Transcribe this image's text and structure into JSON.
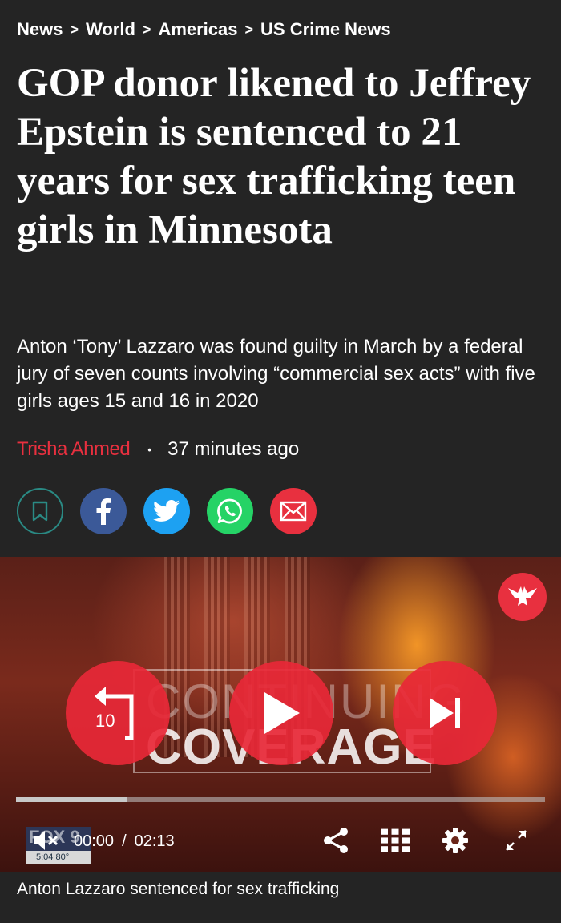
{
  "breadcrumb": {
    "items": [
      "News",
      "World",
      "Americas",
      "US Crime News"
    ],
    "separator": ">"
  },
  "article": {
    "headline": "GOP donor likened to Jeffrey Epstein is sentenced to 21 years for sex trafficking teen girls in Minnesota",
    "standfirst": "Anton ‘Tony’ Lazzaro was found guilty in March by a federal jury of seven counts involving “commercial sex acts” with five girls ages 15 and 16 in 2020",
    "author": "Trisha Ahmed",
    "bullet": "•",
    "published": "37 minutes ago"
  },
  "share": {
    "buttons": [
      {
        "name": "bookmark",
        "icon": "bookmark-icon",
        "color": "#2a8a84"
      },
      {
        "name": "facebook",
        "icon": "facebook-icon",
        "color": "#3b5998"
      },
      {
        "name": "twitter",
        "icon": "twitter-icon",
        "color": "#1da1f2"
      },
      {
        "name": "whatsapp",
        "icon": "whatsapp-icon",
        "color": "#25d366"
      },
      {
        "name": "email",
        "icon": "email-icon",
        "color": "#e8303f"
      }
    ]
  },
  "video": {
    "overlay_line1": "CONTINUING",
    "overlay_line2": "COVERAGE",
    "rewind_label": "10",
    "current_time": "00:00",
    "time_separator": "/",
    "duration": "02:13",
    "progress_fraction": 0.21,
    "station_badge_top": "FOX 9",
    "station_badge_bottom": "5:04  80°",
    "caption": "Anton Lazzaro sentenced for sex trafficking",
    "accent_color": "#e8303f"
  }
}
